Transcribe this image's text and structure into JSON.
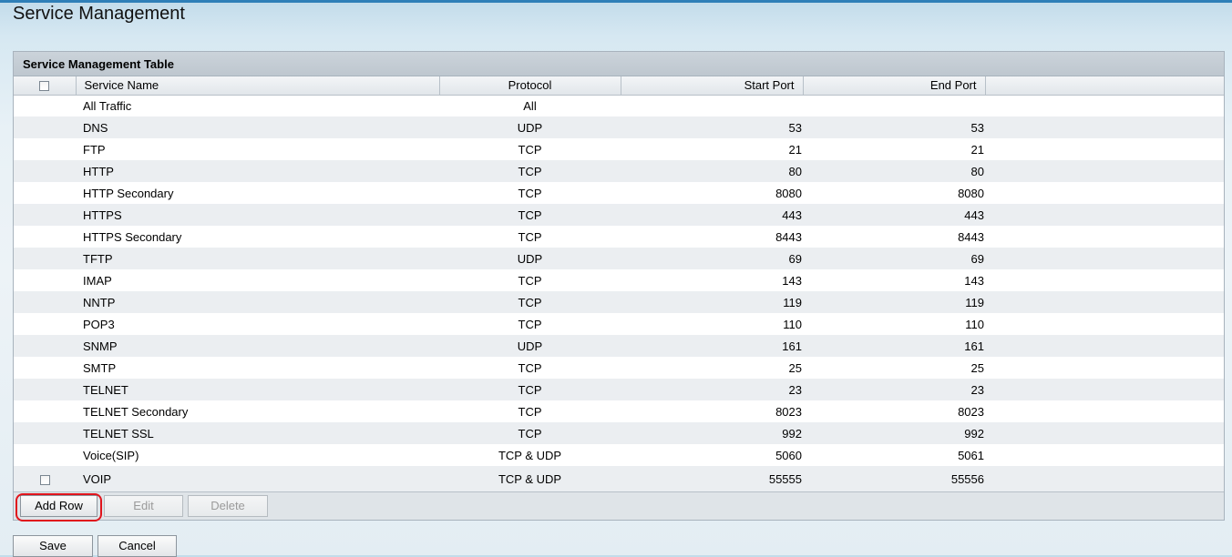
{
  "page": {
    "title": "Service Management"
  },
  "table": {
    "title": "Service Management Table",
    "columns": {
      "service_name": "Service Name",
      "protocol": "Protocol",
      "start_port": "Start Port",
      "end_port": "End Port"
    },
    "rows": [
      {
        "name": "All Traffic",
        "protocol": "All",
        "start": "",
        "end": ""
      },
      {
        "name": "DNS",
        "protocol": "UDP",
        "start": "53",
        "end": "53"
      },
      {
        "name": "FTP",
        "protocol": "TCP",
        "start": "21",
        "end": "21"
      },
      {
        "name": "HTTP",
        "protocol": "TCP",
        "start": "80",
        "end": "80"
      },
      {
        "name": "HTTP Secondary",
        "protocol": "TCP",
        "start": "8080",
        "end": "8080"
      },
      {
        "name": "HTTPS",
        "protocol": "TCP",
        "start": "443",
        "end": "443"
      },
      {
        "name": "HTTPS Secondary",
        "protocol": "TCP",
        "start": "8443",
        "end": "8443"
      },
      {
        "name": "TFTP",
        "protocol": "UDP",
        "start": "69",
        "end": "69"
      },
      {
        "name": "IMAP",
        "protocol": "TCP",
        "start": "143",
        "end": "143"
      },
      {
        "name": "NNTP",
        "protocol": "TCP",
        "start": "119",
        "end": "119"
      },
      {
        "name": "POP3",
        "protocol": "TCP",
        "start": "110",
        "end": "110"
      },
      {
        "name": "SNMP",
        "protocol": "UDP",
        "start": "161",
        "end": "161"
      },
      {
        "name": "SMTP",
        "protocol": "TCP",
        "start": "25",
        "end": "25"
      },
      {
        "name": "TELNET",
        "protocol": "TCP",
        "start": "23",
        "end": "23"
      },
      {
        "name": "TELNET Secondary",
        "protocol": "TCP",
        "start": "8023",
        "end": "8023"
      },
      {
        "name": "TELNET SSL",
        "protocol": "TCP",
        "start": "992",
        "end": "992"
      },
      {
        "name": "Voice(SIP)",
        "protocol": "TCP & UDP",
        "start": "5060",
        "end": "5061"
      },
      {
        "name": "VOIP",
        "protocol": "TCP & UDP",
        "start": "55555",
        "end": "55556"
      }
    ],
    "buttons": {
      "add_row": "Add Row",
      "edit": "Edit",
      "delete": "Delete"
    }
  },
  "form_buttons": {
    "save": "Save",
    "cancel": "Cancel"
  },
  "colors": {
    "highlight": "#e0141c",
    "header_bar": "#bec7cf",
    "row_alt": "#ebeef1"
  }
}
